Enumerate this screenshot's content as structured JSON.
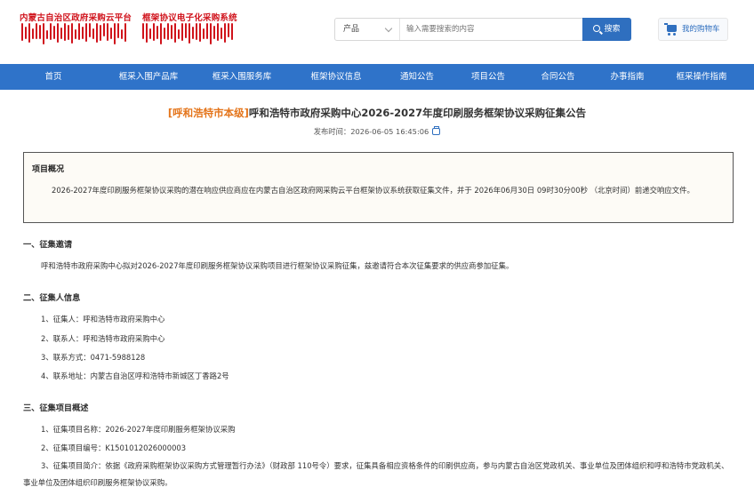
{
  "header": {
    "logo_text_1": "内蒙古自治区政府采购云平台",
    "logo_text_2": "框架协议电子化采购系统",
    "search_category": "产品",
    "search_placeholder": "输入需要搜索的内容",
    "search_button": "搜索",
    "cart_label": "我的购物车",
    "brand_color": "#d0121b",
    "accent_color": "#2f6fbf"
  },
  "nav": {
    "items": [
      {
        "label": "首页"
      },
      {
        "label": "框采入围产品库"
      },
      {
        "label": "框采入围服务库"
      },
      {
        "label": "框架协议信息"
      },
      {
        "label": "通知公告"
      },
      {
        "label": "项目公告"
      },
      {
        "label": "合同公告"
      },
      {
        "label": "办事指南"
      },
      {
        "label": "框采操作指南"
      }
    ]
  },
  "article": {
    "region_tag": "[呼和浩特市本级]",
    "title": "呼和浩特市政府采购中心2026-2027年度印刷服务框架协议采购征集公告",
    "pubtime_label": "发布时间：",
    "pubtime": "2026-06-05 16:45:06",
    "overview": {
      "heading": "项目概况",
      "body": "2026-2027年度印刷服务框架协议采购的潜在响应供应商应在内蒙古自治区政府网采购云平台框架协议系统获取征集文件，并于 2026年06月30日 09时30分00秒 （北京时间）前递交响应文件。"
    },
    "sections": [
      {
        "heading": "一、征集邀请",
        "lines": [
          "呼和浩特市政府采购中心拟对2026-2027年度印刷服务框架协议采购项目进行框架协议采购征集，兹邀请符合本次征集要求的供应商参加征集。"
        ]
      },
      {
        "heading": "二、征集人信息",
        "lines": [
          "1、征集人：呼和浩特市政府采购中心",
          "2、联系人：呼和浩特市政府采购中心",
          "3、联系方式：0471-5988128",
          "4、联系地址：内蒙古自治区呼和浩特市新城区丁香路2号"
        ]
      },
      {
        "heading": "三、征集项目概述",
        "lines": [
          "1、征集项目名称：2026-2027年度印刷服务框架协议采购",
          "2、征集项目编号：K1501012026000003"
        ],
        "para3": "3、征集项目简介：依据《政府采购框架协议采购方式管理暂行办法》（财政部 110号令）要求，征集具备相应资格条件的印刷供应商，参与内蒙古自治区党政机关、事业单位及团体组织和呼和浩特市党政机关、事业单位及团体组织印刷服务框架协议采购。"
      }
    ]
  }
}
